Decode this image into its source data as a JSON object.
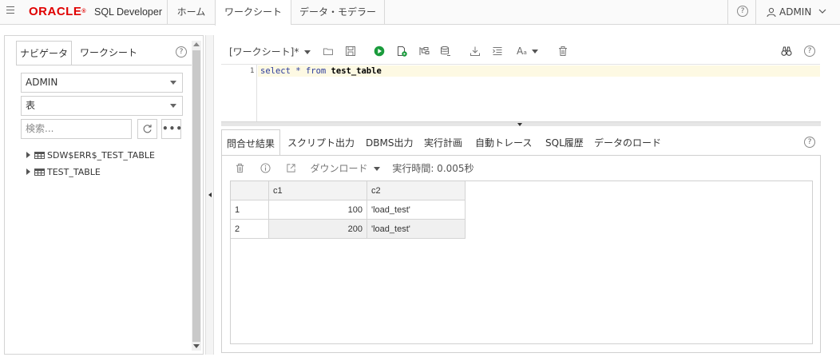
{
  "topbar": {
    "logo": "ORACLE",
    "product": "SQL Developer",
    "tabs": [
      "ホーム",
      "ワークシート",
      "データ・モデラー"
    ],
    "active_tab": "ワークシート",
    "user": "ADMIN"
  },
  "navigator": {
    "tabs": [
      "ナビゲータ",
      "ワークシート"
    ],
    "schema": "ADMIN",
    "object_type": "表",
    "search_placeholder": "検索...",
    "tree": [
      "SDW$ERR$_TEST_TABLE",
      "TEST_TABLE"
    ]
  },
  "worksheet": {
    "title": "[ワークシート]*",
    "line_number": "1",
    "code": {
      "kw1": "select",
      "star": "*",
      "kw2": "from",
      "table": "test_table"
    }
  },
  "results": {
    "tabs": [
      "問合せ結果",
      "スクリプト出力",
      "DBMS出力",
      "実行計画",
      "自動トレース",
      "SQL履歴",
      "データのロード"
    ],
    "download": "ダウンロード",
    "exec_time": "実行時間: 0.005秒",
    "columns": [
      "c1",
      "c2"
    ],
    "rows": [
      {
        "n": "1",
        "c1": "100",
        "c2": "'load_test'"
      },
      {
        "n": "2",
        "c1": "200",
        "c2": "'load_test'"
      }
    ]
  },
  "colors": {
    "brand": "#e00000",
    "run_green": "#1a9b3c",
    "code_highlight": "#fdf9e3"
  }
}
